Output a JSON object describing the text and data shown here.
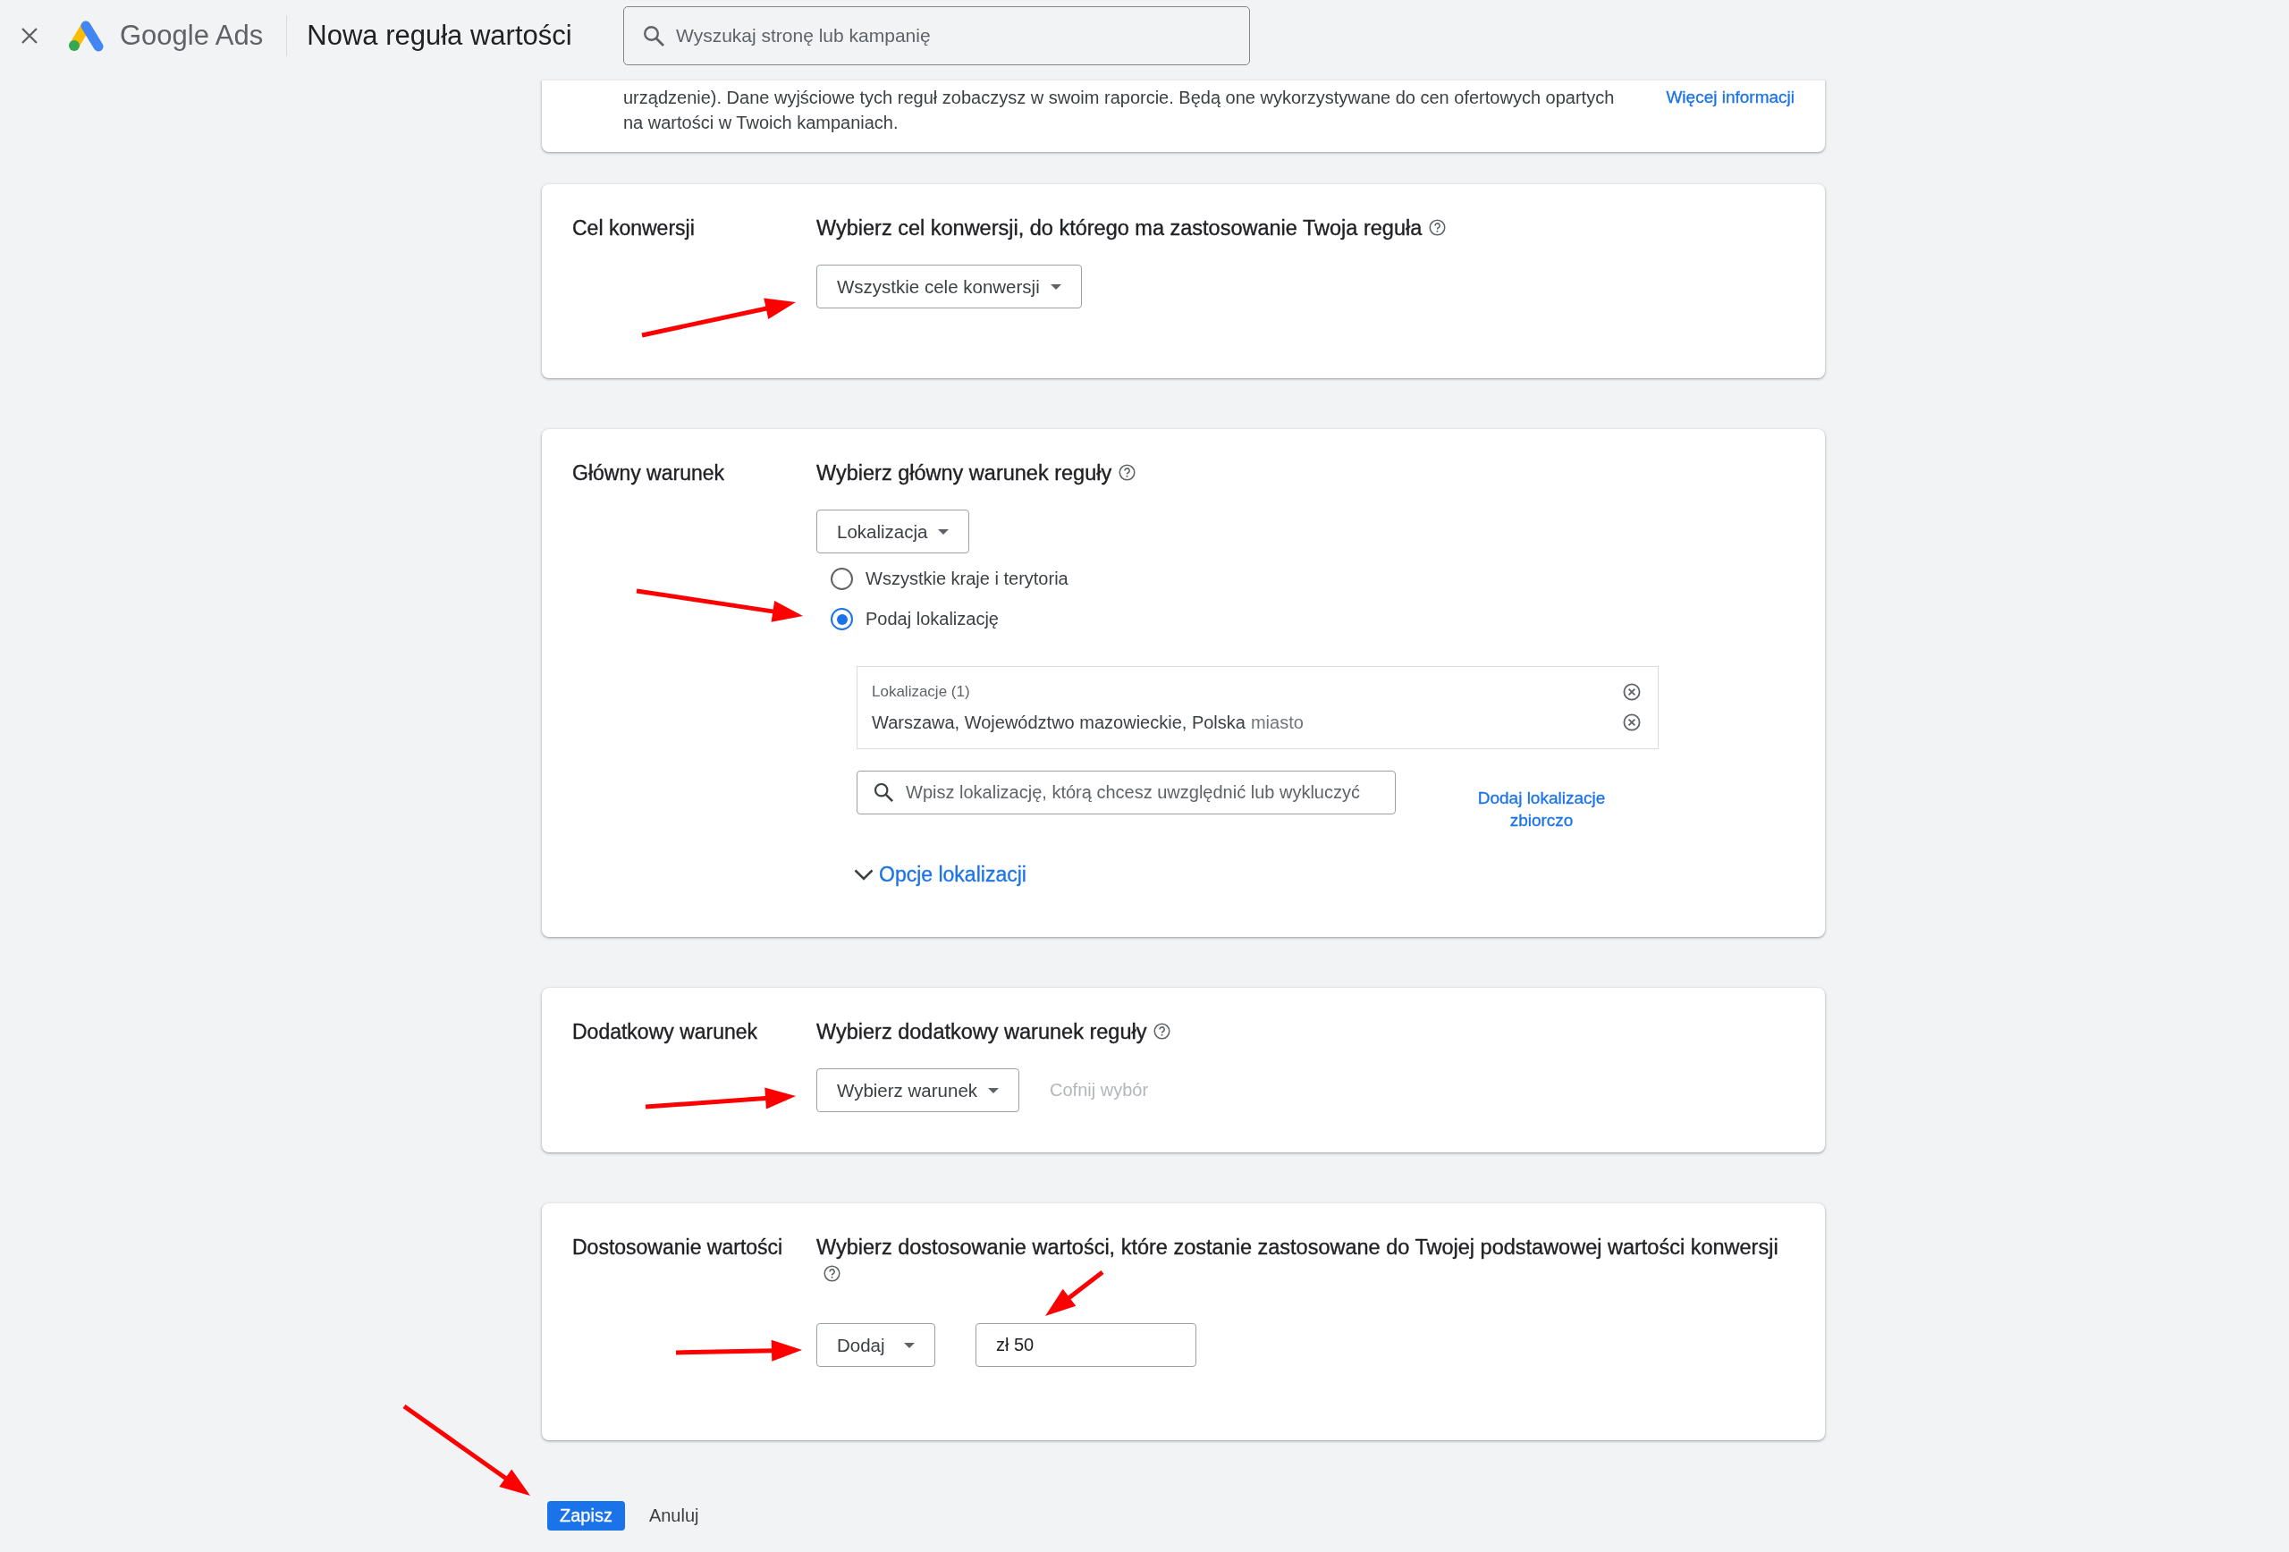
{
  "header": {
    "product": "Google Ads",
    "page_title": "Nowa reguła wartości",
    "search": {
      "placeholder": "Wyszukaj stronę lub kampanię"
    }
  },
  "intro": {
    "text_lines": [
      "urządzenie). Dane wyjściowe tych reguł zobaczysz w swoim raporcie. Będą one wykorzystywane do cen ofertowych opartych",
      "na wartości w Twoich kampaniach."
    ],
    "link": "Więcej informacji"
  },
  "sections": [
    {
      "kind": "select",
      "label": "Cel konwersji",
      "heading": "Wybierz cel konwersji, do którego ma zastosowanie Twoja reguła",
      "dropdown": "Wszystkie cele konwersji"
    },
    {
      "kind": "location",
      "label": "Główny warunek",
      "heading": "Wybierz główny warunek reguły",
      "dropdown": "Lokalizacja",
      "radios": [
        {
          "label": "Wszystkie kraje i terytoria",
          "selected": false
        },
        {
          "label": "Podaj lokalizację",
          "selected": true
        }
      ],
      "locations": {
        "title": "Lokalizacje (1)",
        "items": [
          {
            "name": "Warszawa, Województwo mazowieckie, Polska",
            "type": "miasto"
          }
        ]
      },
      "location_search": {
        "placeholder": "Wpisz lokalizację, którą chcesz uwzględnić lub wykluczyć"
      },
      "bulk_link": "Dodaj lokalizacje zbiorczo",
      "options_toggle": {
        "label": "Opcje lokalizacji",
        "expanded": false
      }
    },
    {
      "kind": "select",
      "label": "Dodatkowy warunek",
      "heading": "Wybierz dodatkowy warunek reguły",
      "dropdown": "Wybierz warunek",
      "clear_action": {
        "label": "Cofnij wybór",
        "disabled": true
      }
    },
    {
      "kind": "value",
      "label": "Dostosowanie wartości",
      "heading": "Wybierz dostosowanie wartości, które zostanie zastosowane do Twojej podstawowej wartości konwersji",
      "dropdown": "Dodaj",
      "amount": {
        "value": "zł 50"
      }
    }
  ],
  "actions": [
    {
      "label": "Zapisz",
      "kind": "primary"
    },
    {
      "label": "Anuluj",
      "kind": "text"
    }
  ]
}
